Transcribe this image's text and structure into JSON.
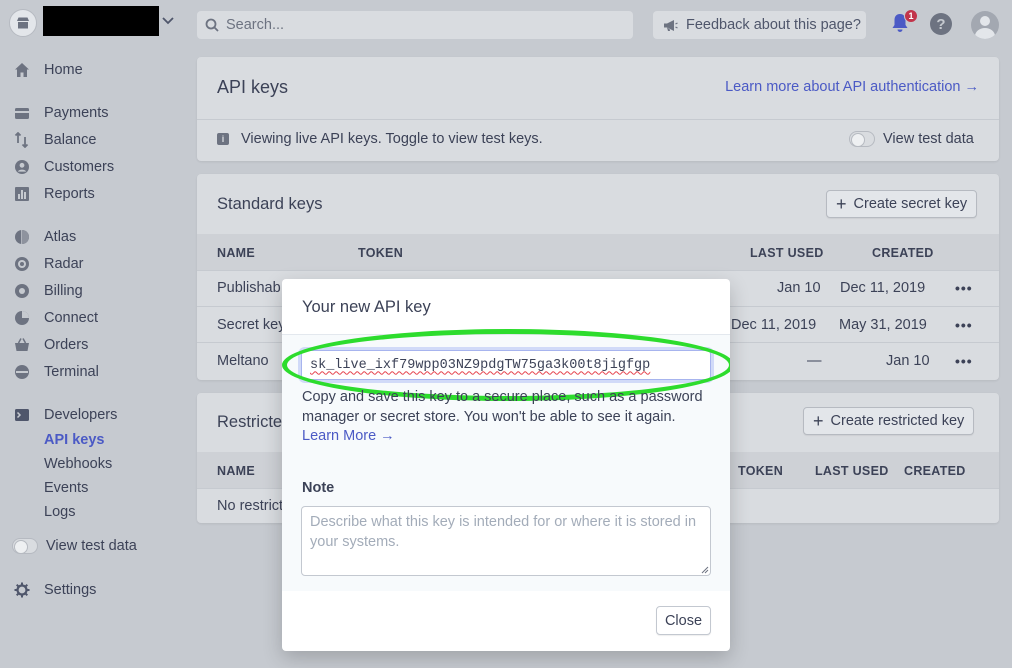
{
  "topbar": {
    "search_placeholder": "Search...",
    "feedback_label": "Feedback about this page?",
    "notification_count": "1",
    "help_label": "?"
  },
  "sidebar": {
    "home": "Home",
    "payments": "Payments",
    "balance": "Balance",
    "customers": "Customers",
    "reports": "Reports",
    "atlas": "Atlas",
    "radar": "Radar",
    "billing": "Billing",
    "connect": "Connect",
    "orders": "Orders",
    "terminal": "Terminal",
    "developers": "Developers",
    "dev_items": [
      "API keys",
      "Webhooks",
      "Events",
      "Logs"
    ],
    "view_test_data": "View test data",
    "settings": "Settings"
  },
  "api_keys_card": {
    "title": "API keys",
    "learn_link": "Learn more about API authentication →",
    "info_text": "Viewing live API keys. Toggle to view test keys.",
    "toggle_label": "View test data"
  },
  "standard_keys": {
    "title": "Standard keys",
    "create_button": "Create secret key",
    "headers": {
      "name": "NAME",
      "token": "TOKEN",
      "last_used": "LAST USED",
      "created": "CREATED"
    },
    "rows": [
      {
        "name": "Publishab",
        "last_used": "Jan 10",
        "created": "Dec 11, 2019"
      },
      {
        "name": "Secret key",
        "last_used": "Dec 11, 2019",
        "created": "May 31, 2019"
      },
      {
        "name": "Meltano",
        "last_used": "—",
        "created": "Jan 10"
      }
    ],
    "more": "•••"
  },
  "restricted_keys": {
    "title": "Restricte",
    "create_button": "Create restricted key",
    "headers": {
      "name": "NAME",
      "token": "TOKEN",
      "last_used": "LAST USED",
      "created": "CREATED"
    },
    "empty_text": "No restrict"
  },
  "modal": {
    "title": "Your new API key",
    "key_value": "sk_live_ixf79wpp03NZ9pdgTW75ga3k00t8jigfgp",
    "copy_text": "Copy and save this key to a secure place, such as a password manager or secret store. You won't be able to see it again.",
    "learn_more": "Learn More →",
    "note_label": "Note",
    "note_placeholder": "Describe what this key is intended for or where it is stored in your systems.",
    "close_label": "Close"
  },
  "colors": {
    "accent": "#4b5ac5",
    "highlight": "#2ddc2d",
    "badge": "#c2344a"
  }
}
